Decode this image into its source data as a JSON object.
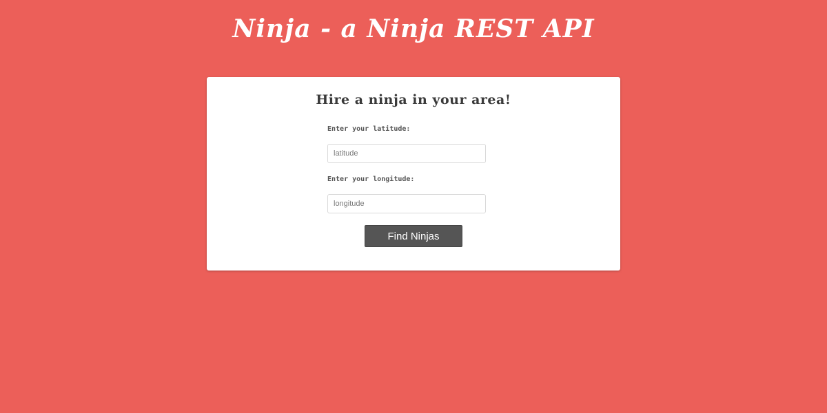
{
  "header": {
    "title": "Ninja - a Ninja REST API"
  },
  "form": {
    "heading": "Hire a ninja in your area!",
    "latitude": {
      "label": "Enter your latitude:",
      "placeholder": "latitude",
      "value": ""
    },
    "longitude": {
      "label": "Enter your longitude:",
      "placeholder": "longitude",
      "value": ""
    },
    "submit_label": "Find Ninjas"
  },
  "colors": {
    "background": "#ec5f59",
    "card": "#ffffff",
    "button": "#555555",
    "button_text": "#ffffff"
  }
}
